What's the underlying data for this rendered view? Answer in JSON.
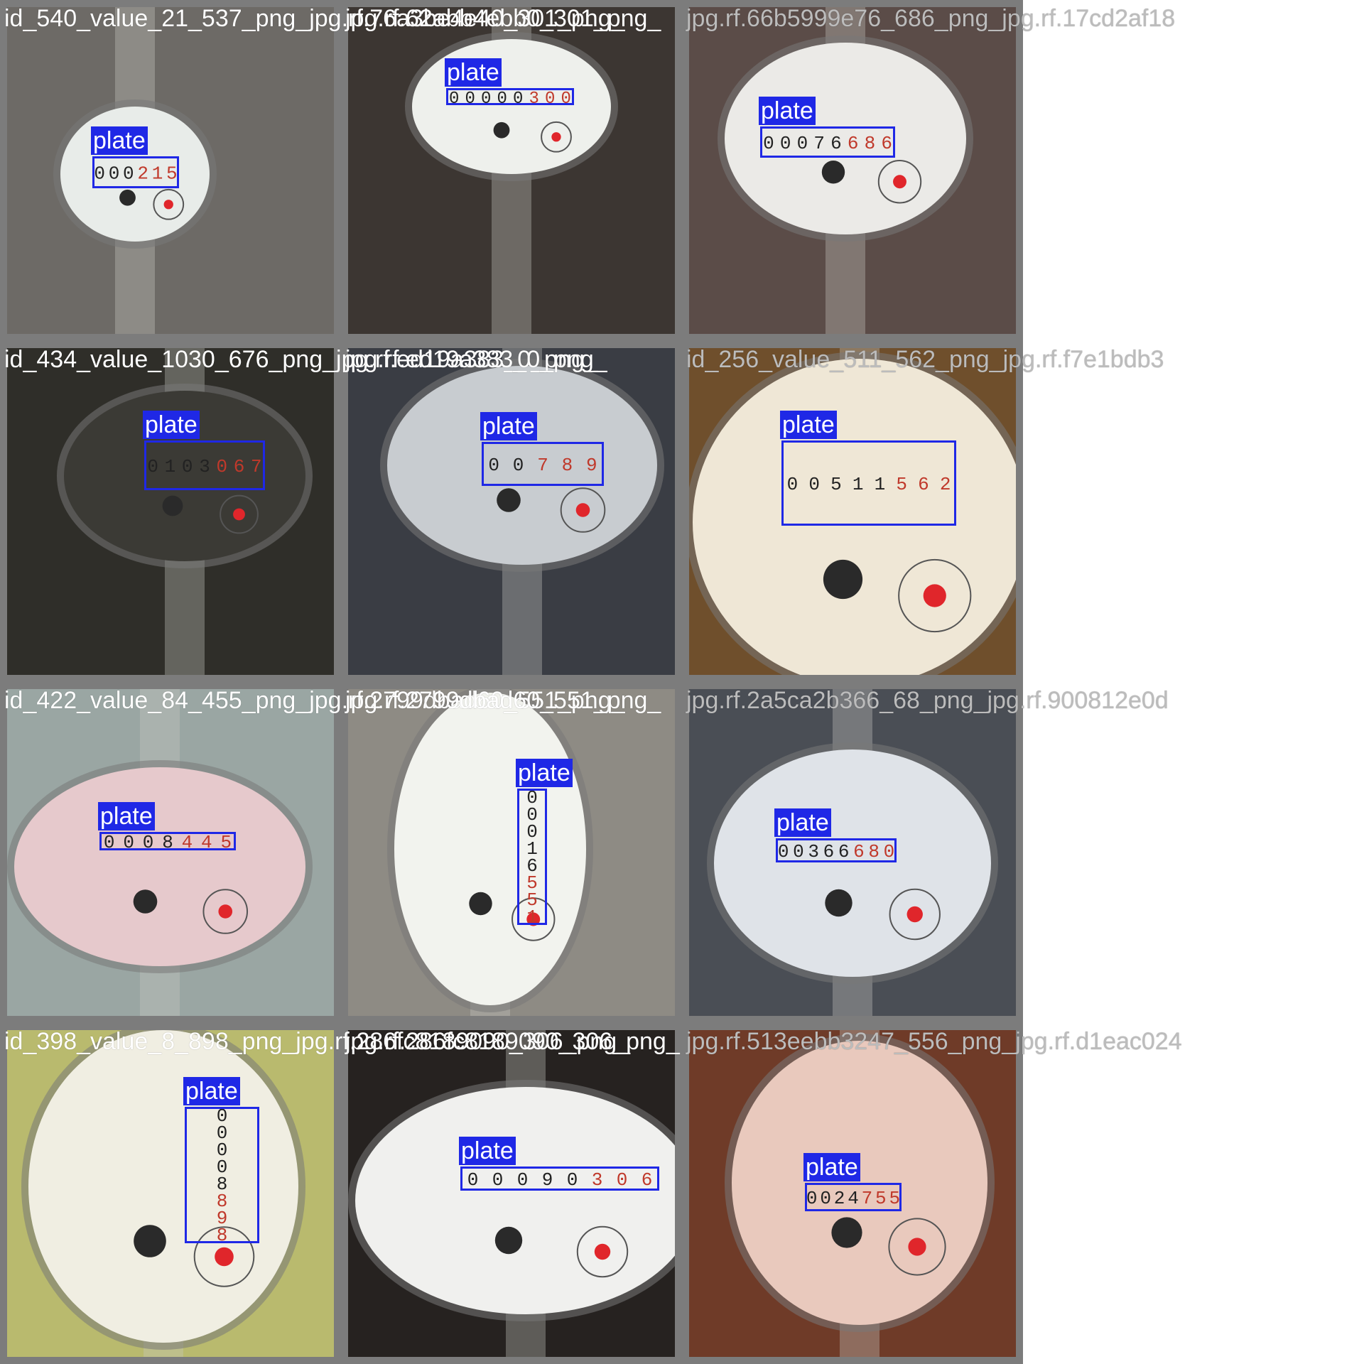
{
  "grid": {
    "background": "#ffffff",
    "tile_border_color": "#7c7c7c",
    "box_color": "#1f28e6",
    "label_text_color": "#ffffff"
  },
  "tiles": [
    {
      "caption": "id_540_value_21_537_png_jpg.rf.76a3be4e40_301_png_",
      "label": "plate",
      "reading": "000215",
      "tone": "#6d6a66"
    },
    {
      "caption": "jpg.rf.62abb4ebb0_301_png_",
      "label": "plate",
      "reading": "00000300",
      "tone": "#3c3632"
    },
    {
      "caption": "jpg.rf.66b5999e76_686_png_jpg.rf.17cd2af18",
      "label": "plate",
      "reading": "00076686",
      "tone": "#5b4c48"
    },
    {
      "caption": "id_434_value_1030_676_png_jpg.rf.ed19a383_0_png_",
      "label": "plate",
      "reading": "0103067",
      "tone": "#2f2e29"
    },
    {
      "caption": "jpg.rf.ed19a383_0_png_",
      "label": "plate",
      "reading": "00789",
      "tone": "#3a3d44"
    },
    {
      "caption": "id_256_value_511_562_png_jpg.rf.f7e1bdb3",
      "label": "plate",
      "reading": "00511562",
      "tone": "#6f4f2c"
    },
    {
      "caption": "id_422_value_84_455_png_jpg.rf.2799dbad60_551_png_",
      "label": "plate",
      "reading": "0008445",
      "tone": "#9aa6a3"
    },
    {
      "caption": "jpg.rf.2799dbad60_551_png_",
      "label": "plate",
      "reading": "00016551",
      "tone": "#8e8b84"
    },
    {
      "caption": "jpg.rf.2a5ca2b366_68_png_jpg.rf.900812e0d",
      "label": "plate",
      "reading": "00366680",
      "tone": "#4a4e55"
    },
    {
      "caption": "id_398_value_8_898_png_jpg.rf.286fc8189090_306_png_",
      "label": "plate",
      "reading": "00008898",
      "tone": "#b9ba6e"
    },
    {
      "caption": "jpg.rf.286fc8189090_306_png_",
      "label": "plate",
      "reading": "00090306",
      "tone": "#262220"
    },
    {
      "caption": "jpg.rf.513eebb3247_556_png_jpg.rf.d1eac024",
      "label": "plate",
      "reading": "0024755",
      "tone": "#6f3b28"
    }
  ]
}
